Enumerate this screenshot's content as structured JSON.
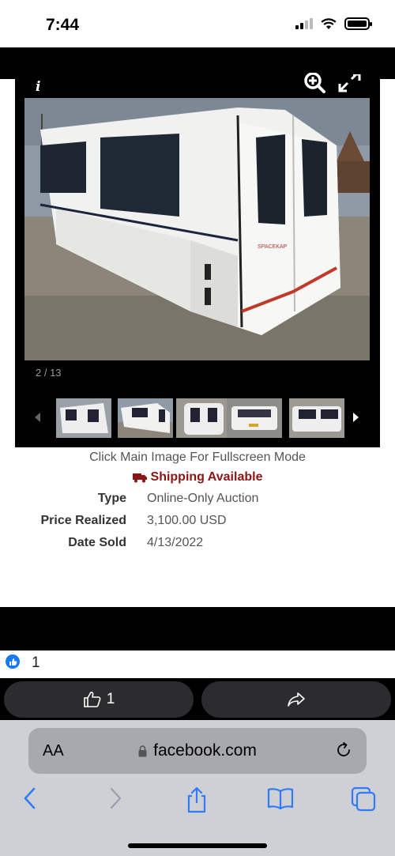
{
  "status_bar": {
    "time": "7:44"
  },
  "gallery": {
    "counter": "2 / 13",
    "main_image_alt": "SPACEKAP",
    "thumbnails": [
      "thumb-1",
      "thumb-2",
      "thumb-3",
      "thumb-4",
      "thumb-5"
    ]
  },
  "listing": {
    "caption": "Click Main Image For Fullscreen Mode",
    "shipping": "Shipping Available",
    "shipping_color": "#8b1515",
    "details": [
      {
        "label": "Type",
        "value": "Online-Only Auction"
      },
      {
        "label": "Price Realized",
        "value": "3,100.00 USD"
      },
      {
        "label": "Date Sold",
        "value": "4/13/2022"
      }
    ]
  },
  "reactions": {
    "count": "1"
  },
  "actions": {
    "like_count": "1"
  },
  "browser": {
    "aa_label": "AA",
    "url": "facebook.com"
  },
  "colors": {
    "facebook_blue": "#1877f2",
    "ios_blue": "#2f7cf6"
  }
}
